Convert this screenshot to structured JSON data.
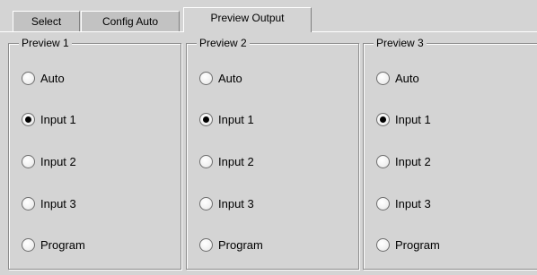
{
  "tabs": [
    {
      "label": "Select",
      "active": false
    },
    {
      "label": "Config Auto",
      "active": false
    },
    {
      "label": "Preview Output",
      "active": true
    }
  ],
  "groups": [
    {
      "title": "Preview 1",
      "options": [
        "Auto",
        "Input 1",
        "Input 2",
        "Input 3",
        "Program"
      ],
      "selected": "Input 1"
    },
    {
      "title": "Preview 2",
      "options": [
        "Auto",
        "Input 1",
        "Input 2",
        "Input 3",
        "Program"
      ],
      "selected": "Input 1"
    },
    {
      "title": "Preview 3",
      "options": [
        "Auto",
        "Input 1",
        "Input 2",
        "Input 3",
        "Program"
      ],
      "selected": "Input 1"
    }
  ],
  "colors": {
    "background": "#d4d4d4",
    "inactive_tab": "#c2c2c2",
    "border_dark": "#8c8c8c",
    "border_light": "#ffffff"
  }
}
